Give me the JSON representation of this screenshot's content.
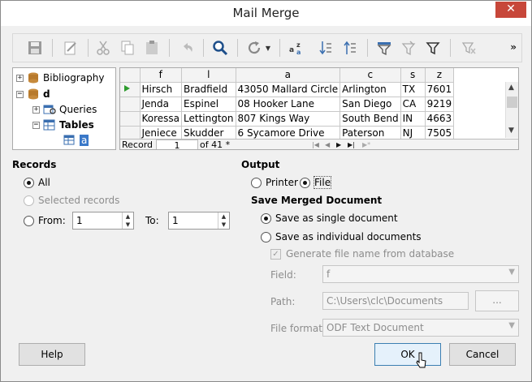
{
  "window": {
    "title": "Mail Merge",
    "close_glyph": "✕"
  },
  "toolbar": {
    "more_glyph": "»"
  },
  "tree": {
    "items": [
      {
        "label": "Bibliography"
      },
      {
        "label": "d"
      },
      {
        "label": "Queries"
      },
      {
        "label": "Tables"
      },
      {
        "label": "a"
      }
    ]
  },
  "grid": {
    "columns": [
      "f",
      "l",
      "a",
      "c",
      "s",
      "z"
    ],
    "rows": [
      [
        "Hirsch",
        "Bradfield",
        "43050 Mallard Circle",
        "Arlington",
        "TX",
        "7601"
      ],
      [
        "Jenda",
        "Espinel",
        "08 Hooker Lane",
        "San Diego",
        "CA",
        "9219"
      ],
      [
        "Koressa",
        "Lettington",
        "807 Kings Way",
        "South Bend",
        "IN",
        "4663"
      ],
      [
        "Jeniece",
        "Skudder",
        "6 Sycamore Drive",
        "Paterson",
        "NJ",
        "7505"
      ]
    ],
    "nav": {
      "record_label": "Record",
      "record_value": "1",
      "of_label": "of 41 *"
    }
  },
  "records": {
    "heading": "Records",
    "all": "All",
    "selected": "Selected records",
    "from": "From:",
    "from_value": "1",
    "to": "To:",
    "to_value": "1"
  },
  "output": {
    "heading": "Output",
    "printer": "Printer",
    "file": "File",
    "save_heading": "Save Merged Document",
    "single": "Save as single document",
    "individual": "Save as individual documents",
    "generate": "Generate file name from database",
    "field_label": "Field:",
    "field_value": "f",
    "path_label": "Path:",
    "path_value": "C:\\Users\\clc\\Documents",
    "browse_label": "...",
    "format_label": "File format:",
    "format_value": "ODF Text Document"
  },
  "buttons": {
    "help": "Help",
    "ok": "OK",
    "cancel": "Cancel"
  }
}
